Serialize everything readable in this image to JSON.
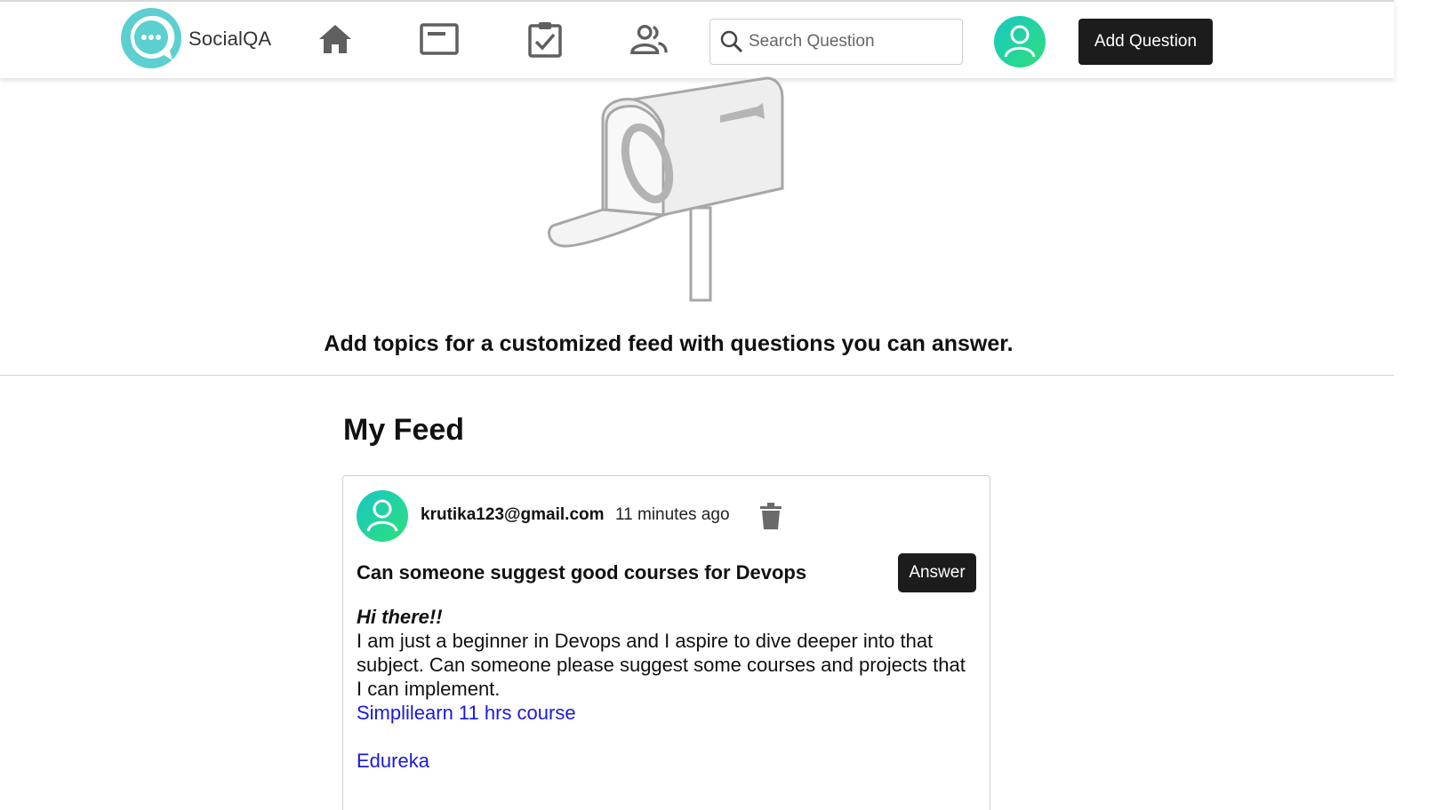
{
  "header": {
    "app_name": "SocialQA",
    "nav_icons": [
      "home-icon",
      "feed-icon",
      "tasks-icon",
      "people-icon"
    ],
    "search": {
      "placeholder": "Search Question",
      "value": ""
    },
    "add_question_label": "Add Question"
  },
  "banner": {
    "illustration": "mailbox-illustration",
    "message": "Add topics for a customized feed with questions you can answer."
  },
  "feed": {
    "title": "My Feed",
    "posts": [
      {
        "author": "krutika123@gmail.com",
        "time": "11 minutes ago",
        "question": "Can someone suggest good courses for Devops",
        "answer_label": "Answer",
        "greeting": "Hi there!!",
        "body": "I am just a beginner in Devops and I aspire to dive deeper into that subject. Can someone please suggest some courses and projects that I can implement.",
        "links": [
          "Simplilearn 11 hrs course",
          "Edureka"
        ]
      }
    ]
  },
  "colors": {
    "accent_dark": "#1c1c1c",
    "avatar_gradient_start": "#17c7c4",
    "avatar_gradient_end": "#2ee07a",
    "link": "#1a1adb",
    "logo_teal": "#5ccfd0"
  }
}
